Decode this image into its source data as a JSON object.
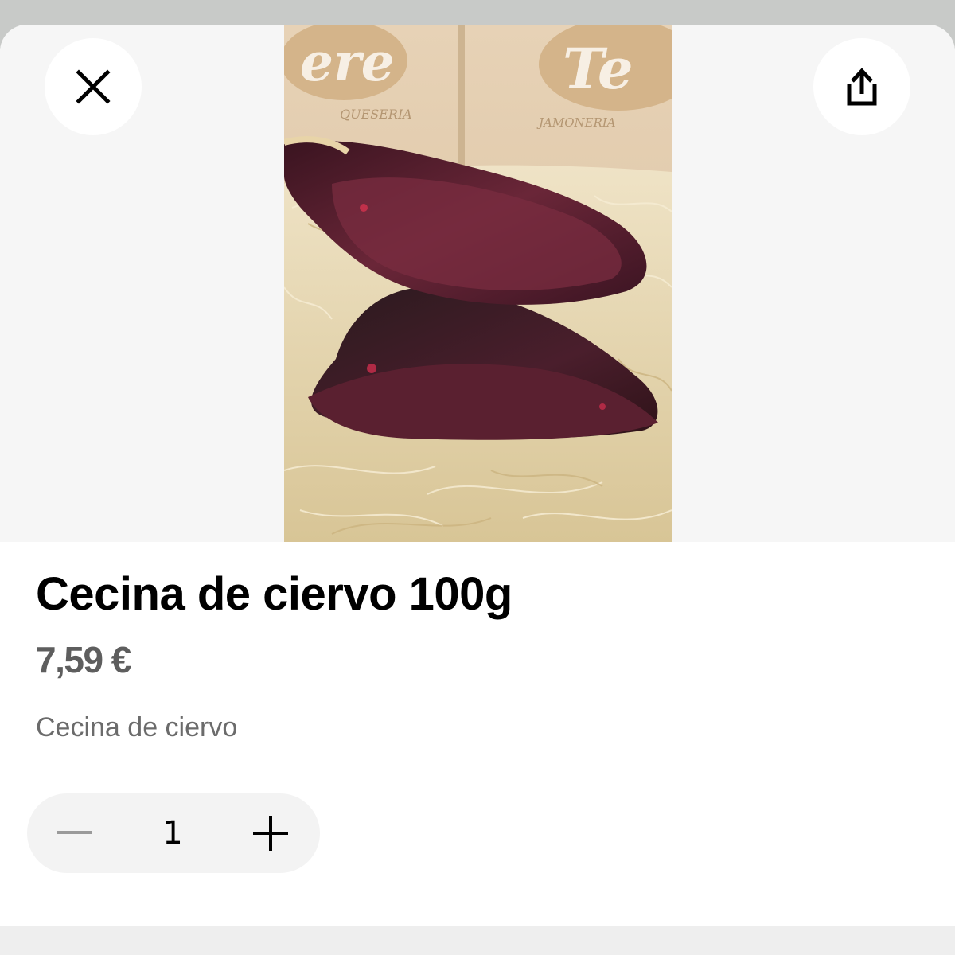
{
  "product": {
    "title": "Cecina de ciervo 100g",
    "price": "7,59 €",
    "description": "Cecina de ciervo",
    "image": {
      "subject": "cured venison pieces on wood wool",
      "sign_text_left": "ere",
      "sign_subtext_left": "QUESERIA",
      "sign_text_right": "Te",
      "sign_subtext_right": "JAMONERIA"
    }
  },
  "header": {
    "close_icon": "close-icon",
    "share_icon": "share-icon"
  },
  "quantity": {
    "value": "1",
    "minus_icon": "minus-icon",
    "plus_icon": "plus-icon"
  }
}
